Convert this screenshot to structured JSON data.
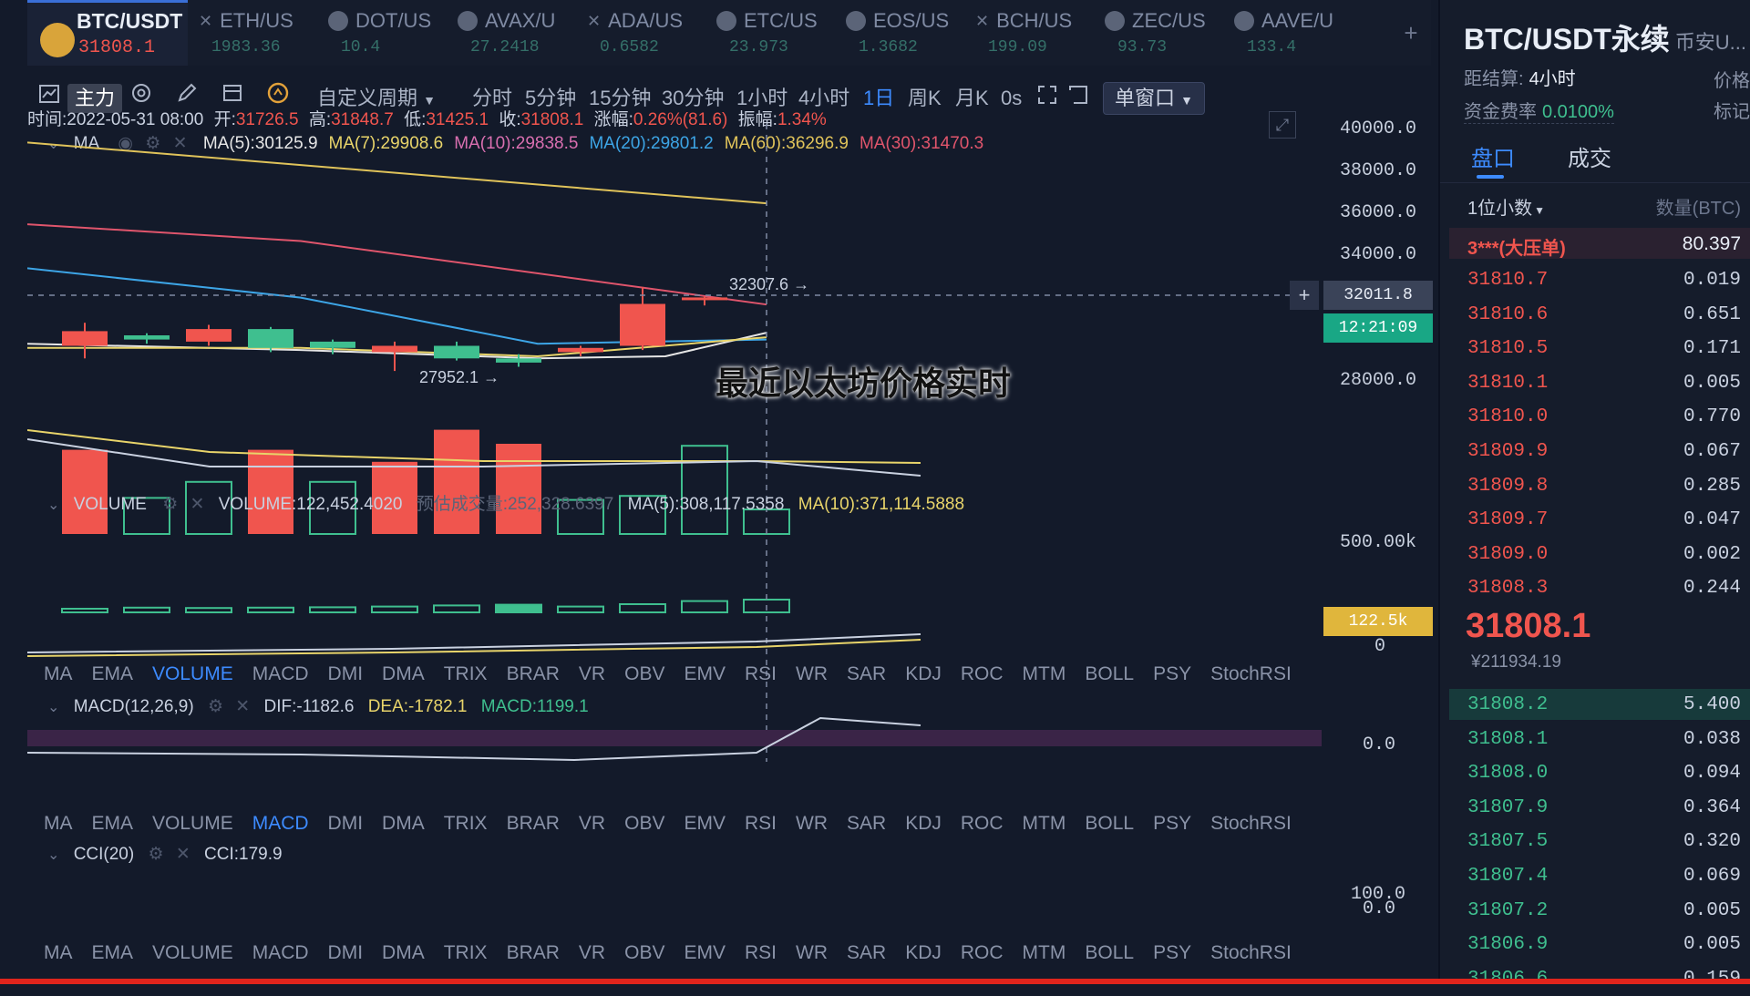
{
  "tabs": [
    {
      "symbol": "BTC/USDT",
      "price": "31808.1",
      "active": true
    },
    {
      "symbol": "ETH/US",
      "price": "1983.36",
      "active": false
    },
    {
      "symbol": "DOT/US",
      "price": "10.4",
      "active": false
    },
    {
      "symbol": "AVAX/U",
      "price": "27.2418",
      "active": false
    },
    {
      "symbol": "ADA/US",
      "price": "0.6582",
      "active": false
    },
    {
      "symbol": "ETC/US",
      "price": "23.973",
      "active": false
    },
    {
      "symbol": "EOS/US",
      "price": "1.3682",
      "active": false
    },
    {
      "symbol": "BCH/US",
      "price": "199.09",
      "active": false
    },
    {
      "symbol": "ZEC/US",
      "price": "93.73",
      "active": false
    },
    {
      "symbol": "AAVE/U",
      "price": "133.4",
      "active": false
    }
  ],
  "add_tab_label": "+",
  "toolbar": {
    "main_label": "主力",
    "custom_period": "自定义周期",
    "periods": [
      "分时",
      "5分钟",
      "15分钟",
      "30分钟",
      "1小时",
      "4小时",
      "1日",
      "周K",
      "月K",
      "0s"
    ],
    "selected_period": "1日",
    "window_label": "单窗口"
  },
  "ohlc": {
    "time_label": "时间:2022-05-31 08:00",
    "open_label": "开:",
    "open": "31726.5",
    "high_label": "高:",
    "high": "31848.7",
    "low_label": "低:",
    "low": "31425.1",
    "close_label": "收:",
    "close": "31808.1",
    "change_label": "涨幅:",
    "change": "0.26%(81.6)",
    "amp_label": "振幅:",
    "amp": "1.34%"
  },
  "ma_legend": {
    "title": "MA",
    "items": [
      {
        "text": "MA(5):30125.9",
        "color": "#e6e6e6"
      },
      {
        "text": "MA(7):29908.6",
        "color": "#e8d46a"
      },
      {
        "text": "MA(10):29838.5",
        "color": "#d96fb0"
      },
      {
        "text": "MA(20):29801.2",
        "color": "#3da5e6"
      },
      {
        "text": "MA(60):36296.9",
        "color": "#e0c35a"
      },
      {
        "text": "MA(30):31470.3",
        "color": "#e0556c"
      }
    ]
  },
  "price_axis": [
    "40000.0",
    "38000.0",
    "36000.0",
    "34000.0",
    "28000.0"
  ],
  "crosshair_price": "32011.8",
  "countdown": "12:21:09",
  "high_mark": "32307.6 →",
  "low_mark": "27952.1 →",
  "overlay_caption": "最近以太坊价格实时",
  "volume_legend": {
    "title": "VOLUME",
    "volume": "VOLUME:122,452.4020",
    "estimate": "预估成交量:252,328.6397",
    "ma5": "MA(5):308,117.5358",
    "ma10": "MA(10):371,114.5888"
  },
  "volume_axis": [
    "500.00k",
    "0"
  ],
  "volume_current_tag": "122.5k",
  "indicator_tabs": [
    "MA",
    "EMA",
    "VOLUME",
    "MACD",
    "DMI",
    "DMA",
    "TRIX",
    "BRAR",
    "VR",
    "OBV",
    "EMV",
    "RSI",
    "WR",
    "SAR",
    "KDJ",
    "ROC",
    "MTM",
    "BOLL",
    "PSY",
    "StochRSI"
  ],
  "macd_legend": {
    "title": "MACD(12,26,9)",
    "dif": "DIF:-1182.6",
    "dea": "DEA:-1782.1",
    "macd": "MACD:1199.1"
  },
  "macd_axis": [
    "0.0"
  ],
  "cci_legend": {
    "title": "CCI(20)",
    "value": "CCI:179.9"
  },
  "cci_axis": [
    "100.0",
    "0.0"
  ],
  "right_panel": {
    "title": "BTC/USDT永续",
    "title_suffix": "币安U...",
    "funding_label": "距结算:",
    "funding_time": "4小时",
    "funding_rate_label": "资金费率",
    "funding_rate": "0.0100%",
    "right_hint1": "价格",
    "right_hint2": "标记",
    "tabs": [
      "盘口",
      "成交"
    ],
    "precision": "1位小数",
    "qty_header": "数量(BTC)",
    "big_label": "3***(大压单)",
    "big_qty": "80.397",
    "asks": [
      {
        "p": "31810.7",
        "q": "0.019"
      },
      {
        "p": "31810.6",
        "q": "0.651"
      },
      {
        "p": "31810.5",
        "q": "0.171"
      },
      {
        "p": "31810.1",
        "q": "0.005"
      },
      {
        "p": "31810.0",
        "q": "0.770"
      },
      {
        "p": "31809.9",
        "q": "0.067"
      },
      {
        "p": "31809.8",
        "q": "0.285"
      },
      {
        "p": "31809.7",
        "q": "0.047"
      },
      {
        "p": "31809.0",
        "q": "0.002"
      },
      {
        "p": "31808.3",
        "q": "0.244"
      }
    ],
    "last_price": "31808.1",
    "last_price_cny": "¥211934.19",
    "bids": [
      {
        "p": "31808.2",
        "q": "5.400"
      },
      {
        "p": "31808.1",
        "q": "0.038"
      },
      {
        "p": "31808.0",
        "q": "0.094"
      },
      {
        "p": "31807.9",
        "q": "0.364"
      },
      {
        "p": "31807.5",
        "q": "0.320"
      },
      {
        "p": "31807.4",
        "q": "0.069"
      },
      {
        "p": "31807.2",
        "q": "0.005"
      },
      {
        "p": "31806.9",
        "q": "0.005"
      },
      {
        "p": "31806.6",
        "q": "0.159"
      }
    ]
  },
  "colors": {
    "up": "#f0554e",
    "down": "#3fbf8f",
    "accent": "#3d8bff",
    "ma60": "#e0c35a",
    "ma30": "#e0556c",
    "ma20": "#3da5e6"
  },
  "chart_data": {
    "type": "candlestick",
    "candles": [
      {
        "open": 29500,
        "close": 30200,
        "high": 30600,
        "low": 28900
      },
      {
        "open": 30000,
        "close": 29800,
        "high": 30100,
        "low": 29600
      },
      {
        "open": 29700,
        "close": 30300,
        "high": 30500,
        "low": 29500
      },
      {
        "open": 30300,
        "close": 29400,
        "high": 30400,
        "low": 29200
      },
      {
        "open": 29700,
        "close": 29400,
        "high": 29800,
        "low": 29100
      },
      {
        "open": 29200,
        "close": 29500,
        "high": 29700,
        "low": 28300
      },
      {
        "open": 29500,
        "close": 28900,
        "high": 29700,
        "low": 28800
      },
      {
        "open": 28900,
        "close": 28700,
        "high": 29100,
        "low": 28500
      },
      {
        "open": 29200,
        "close": 29400,
        "high": 29500,
        "low": 29000
      },
      {
        "open": 29500,
        "close": 31500,
        "high": 32307.6,
        "low": 29300
      },
      {
        "open": 31726.5,
        "close": 31808.1,
        "high": 31848.7,
        "low": 31425.1
      }
    ],
    "volumes": [
      420000,
      180000,
      260000,
      420000,
      260000,
      360000,
      520000,
      450000,
      170000,
      190000,
      440000,
      122452
    ],
    "volume_up": [
      true,
      false,
      false,
      true,
      false,
      true,
      true,
      true,
      false,
      false,
      false,
      false
    ],
    "macd": [
      200,
      260,
      240,
      260,
      280,
      320,
      380,
      420,
      320,
      450,
      620,
      700
    ]
  }
}
